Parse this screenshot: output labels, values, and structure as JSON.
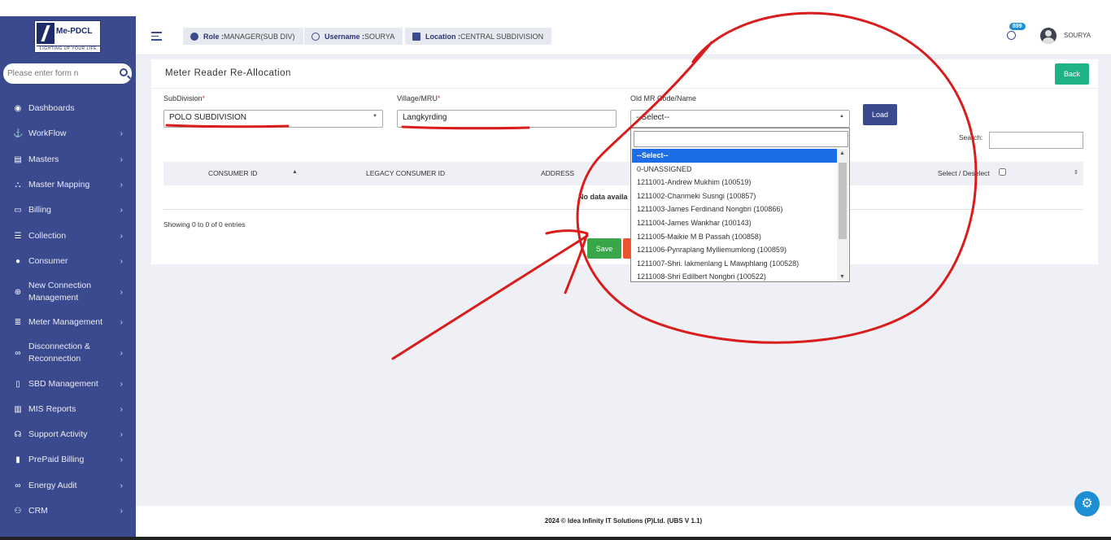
{
  "app": {
    "logo_brand": "Me-PDCL",
    "logo_tagline": "LIGHTING UP YOUR LIFE"
  },
  "sidebar": {
    "search_placeholder": "Please enter form n",
    "items": [
      {
        "label": "Dashboards",
        "icon": "dashboard-icon",
        "glyph": "◉",
        "chevron": false
      },
      {
        "label": "WorkFlow",
        "icon": "anchor-icon",
        "glyph": "⚓",
        "chevron": true
      },
      {
        "label": "Masters",
        "icon": "table-icon",
        "glyph": "▤",
        "chevron": true
      },
      {
        "label": "Master Mapping",
        "icon": "sitemap-icon",
        "glyph": "⛬",
        "chevron": true
      },
      {
        "label": "Billing",
        "icon": "desktop-icon",
        "glyph": "▭",
        "chevron": true
      },
      {
        "label": "Collection",
        "icon": "list-icon",
        "glyph": "☰",
        "chevron": true
      },
      {
        "label": "Consumer",
        "icon": "user-icon",
        "glyph": "●",
        "chevron": true
      },
      {
        "label": "New Connection Management",
        "icon": "plus-circle-icon",
        "glyph": "⊕",
        "chevron": true
      },
      {
        "label": "Meter Management",
        "icon": "list-alt-icon",
        "glyph": "≣",
        "chevron": true
      },
      {
        "label": "Disconnection & Reconnection",
        "icon": "link-icon",
        "glyph": "∞",
        "chevron": true
      },
      {
        "label": "SBD Management",
        "icon": "mobile-icon",
        "glyph": "▯",
        "chevron": true
      },
      {
        "label": "MIS Reports",
        "icon": "bar-chart-icon",
        "glyph": "▥",
        "chevron": true
      },
      {
        "label": "Support Activity",
        "icon": "headset-icon",
        "glyph": "☊",
        "chevron": true
      },
      {
        "label": "PrePaid Billing",
        "icon": "file-icon",
        "glyph": "▮",
        "chevron": true
      },
      {
        "label": "Energy Audit",
        "icon": "link-icon",
        "glyph": "∞",
        "chevron": true
      },
      {
        "label": "CRM",
        "icon": "users-icon",
        "glyph": "⚇",
        "chevron": true
      }
    ],
    "chevron_glyph": "›"
  },
  "header": {
    "role_label": "Role :",
    "role_value": "MANAGER(SUB DIV)",
    "username_label": "Username :",
    "username_value": "SOURYA",
    "location_label": "Location :",
    "location_value": "CENTRAL SUBDIVISION",
    "notification_count": "899",
    "user_name": "SOURYA"
  },
  "page": {
    "title": "Meter Reader Re-Allocation",
    "back_label": "Back",
    "load_label": "Load",
    "save_label": "Save",
    "subdivision_label": "SubDivision",
    "subdivision_value": "POLO SUBDIVISION",
    "village_label": "Village/MRU",
    "village_value": "Langkyrding",
    "oldmr_label": "Old MR Code/Name",
    "oldmr_value": "--Select--",
    "required_mark": "*",
    "search_label": "Search:",
    "columns": [
      "CONSUMER ID",
      "LEGACY CONSUMER ID",
      "ADDRESS",
      "Select / Deselect"
    ],
    "no_data": "No data availa",
    "showing": "Showing 0 to 0 of 0 entries"
  },
  "dropdown": {
    "options": [
      "--Select--",
      "0-UNASSIGNED",
      "1211001-Andrew Mukhim (100519)",
      "1211002-Chanmeki Susngi (100857)",
      "1211003-James Ferdinand Nongbri (100866)",
      "1211004-James Wankhar (100143)",
      "1211005-Maikie M B Passah (100858)",
      "1211006-Pynraplang Mylliemumlong (100859)",
      "1211007-Shri. Iakmenlang L Mawphlang (100528)",
      "1211008-Shri Edilbert Nongbri (100522)"
    ],
    "selected_index": 0
  },
  "footer": {
    "text": "2024 © Idea Infinity IT Solutions (P)Ltd. (UBS V 1.1)"
  },
  "colors": {
    "sidebar_bg": "#3b4a8f",
    "accent_green": "#1db386",
    "save_green": "#3aa64a",
    "annotation_red": "#d91c1c",
    "option_highlight": "#1d6ee6"
  }
}
